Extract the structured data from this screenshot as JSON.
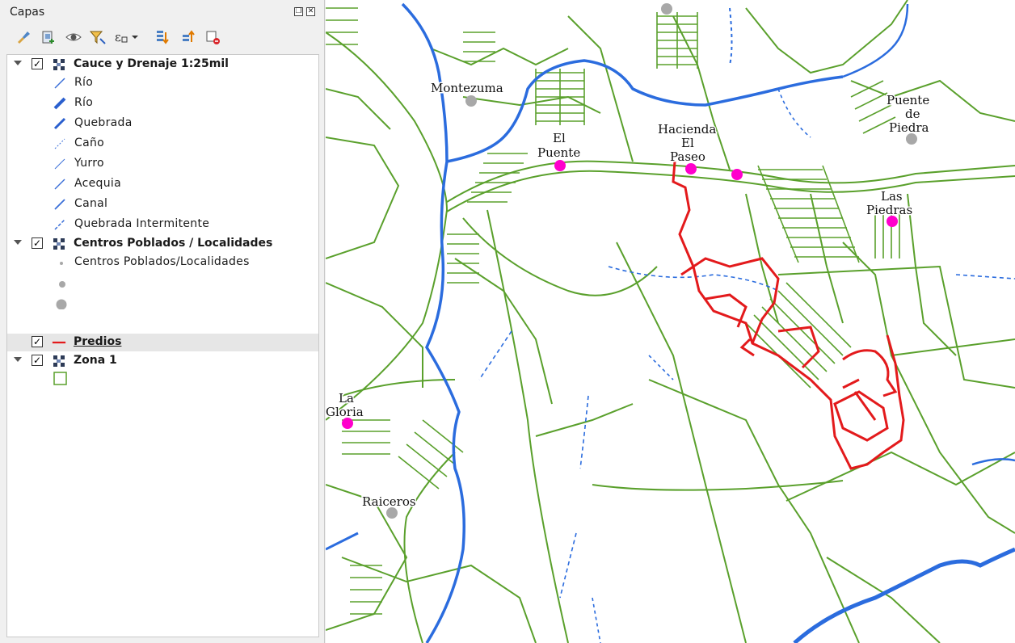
{
  "panel": {
    "title": "Capas",
    "header_buttons": [
      {
        "icon": "float-panel-icon",
        "glyph": "❐"
      },
      {
        "icon": "close-icon",
        "glyph": "✕"
      }
    ],
    "toolbar": [
      {
        "icon": "style-brush-icon"
      },
      {
        "icon": "add-group-icon"
      },
      {
        "icon": "eye-visibility-icon"
      },
      {
        "icon": "filter-legend-icon"
      },
      {
        "icon": "filter-expression-icon"
      },
      {
        "icon": "expand-all-icon"
      },
      {
        "icon": "collapse-all-icon"
      },
      {
        "icon": "remove-layer-icon"
      }
    ]
  },
  "layers": {
    "cauce": {
      "name": "Cauce y Drenaje 1:25mil",
      "checked": true,
      "items": [
        "Río",
        "Río",
        "Quebrada",
        "Caño",
        "Yurro",
        "Acequia",
        "Canal",
        "Quebrada Intermitente"
      ]
    },
    "centros": {
      "name": "Centros Poblados / Localidades",
      "checked": true,
      "items": [
        "Centros Poblados/Localidades",
        "",
        ""
      ]
    },
    "predios": {
      "name": "Predios",
      "checked": true,
      "color": "#e31a1c"
    },
    "zona": {
      "name": "Zona 1",
      "checked": true,
      "color": "#5aa02c"
    }
  },
  "map": {
    "parcel_color": "#5aa02c",
    "predios_color": "#e31a1c",
    "river_color": "#2b6cde",
    "place_color_magenta": "#ff00cc",
    "place_color_gray": "#a8a8a8",
    "places": {
      "montezuma": "Montezuma",
      "el_puente": [
        "El",
        "Puente"
      ],
      "hacienda": [
        "Hacienda",
        "El",
        "Paseo"
      ],
      "puente_piedra": [
        "Puente",
        "de",
        "Piedra"
      ],
      "las_piedras": [
        "Las",
        "Piedras"
      ],
      "la_gloria": [
        "La",
        "Gloria"
      ],
      "raiceros": "Raiceros"
    }
  }
}
